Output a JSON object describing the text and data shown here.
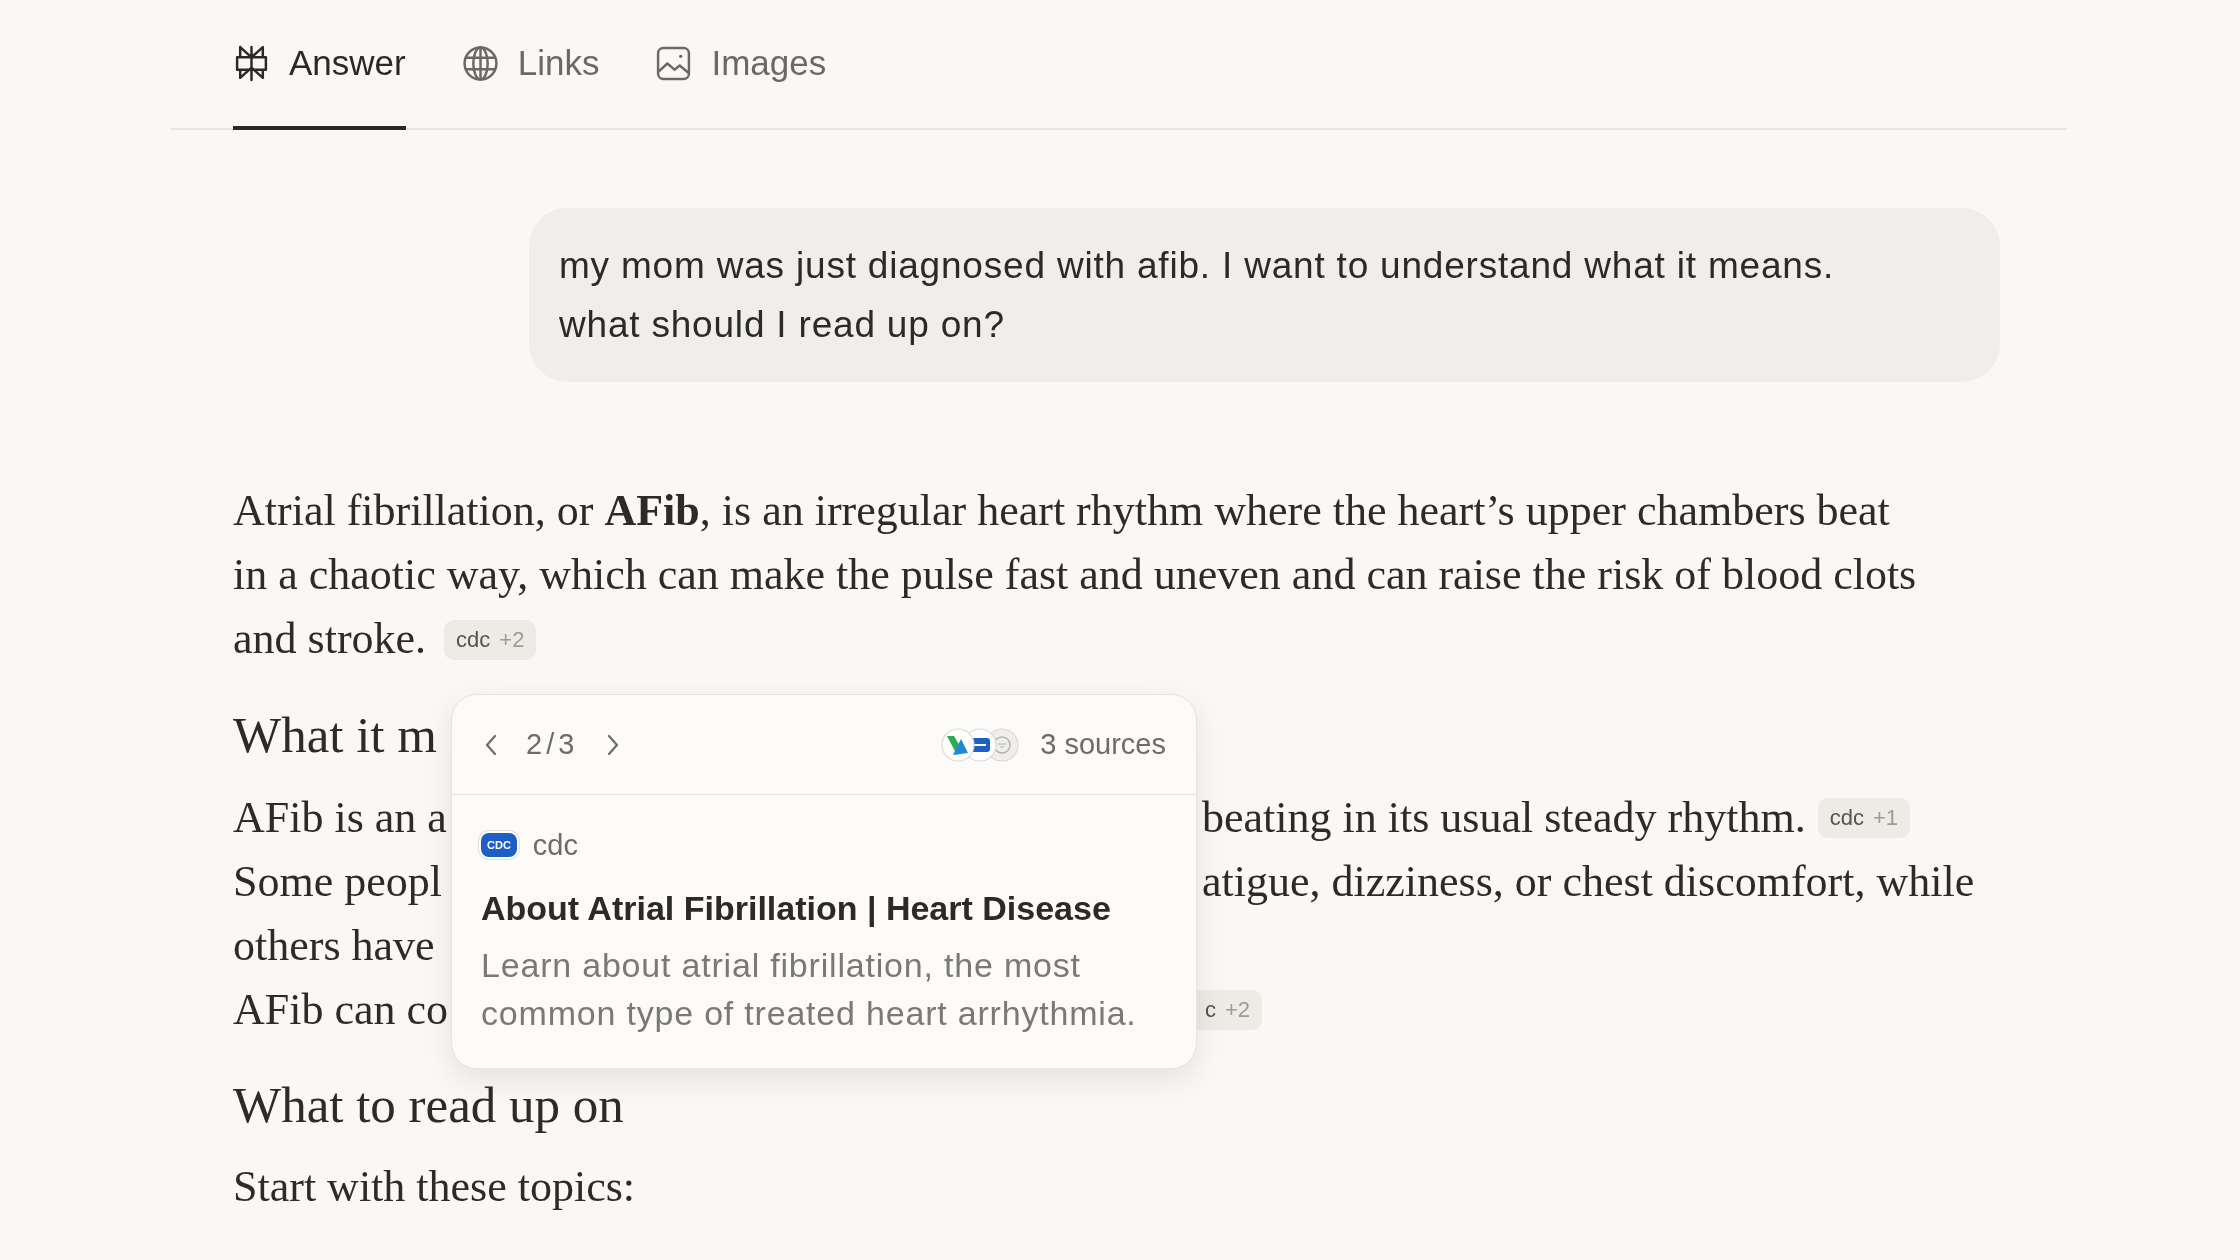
{
  "tabs": [
    {
      "kind": "answer",
      "label": "Answer",
      "selected": true
    },
    {
      "kind": "links",
      "label": "Links",
      "selected": false
    },
    {
      "kind": "images",
      "label": "Images",
      "selected": false
    }
  ],
  "user_message": "my mom was just diagnosed with afib. I want to understand what it means.\nwhat should I read up on?",
  "answer": {
    "intro": {
      "text": "Atrial fibrillation, or **AFib**, is an irregular heart rhythm where the heart’s upper chambers beat in a chaotic way, which can make the pulse fast and uneven and can raise the risk of blood clots and stroke.",
      "citation": {
        "source": "cdc",
        "more": "+2"
      }
    },
    "section_1": {
      "heading": "What it m",
      "lines": [
        {
          "start": "AFib is an a",
          "end": "beating in its usual steady rhythm.",
          "citation": {
            "source": "cdc",
            "more": "+1"
          }
        },
        {
          "start": "Some peopl",
          "end": "atigue, dizziness, or chest discomfort, while"
        },
        {
          "start": "others have"
        },
        {
          "start": "AFib can co",
          "citation": {
            "source": "c",
            "more": "+2"
          }
        }
      ]
    },
    "section_2": {
      "heading": "What to read up on",
      "text": "Start with these topics:"
    }
  },
  "source_popup": {
    "position": "2/3",
    "source_count": "3 sources",
    "source": {
      "logo_text": "CDC",
      "name": "cdc"
    },
    "title": "About Atrial Fibrillation | Heart Disease",
    "description": "Learn about atrial fibrillation, the most common type of treated heart arrhythmia."
  }
}
